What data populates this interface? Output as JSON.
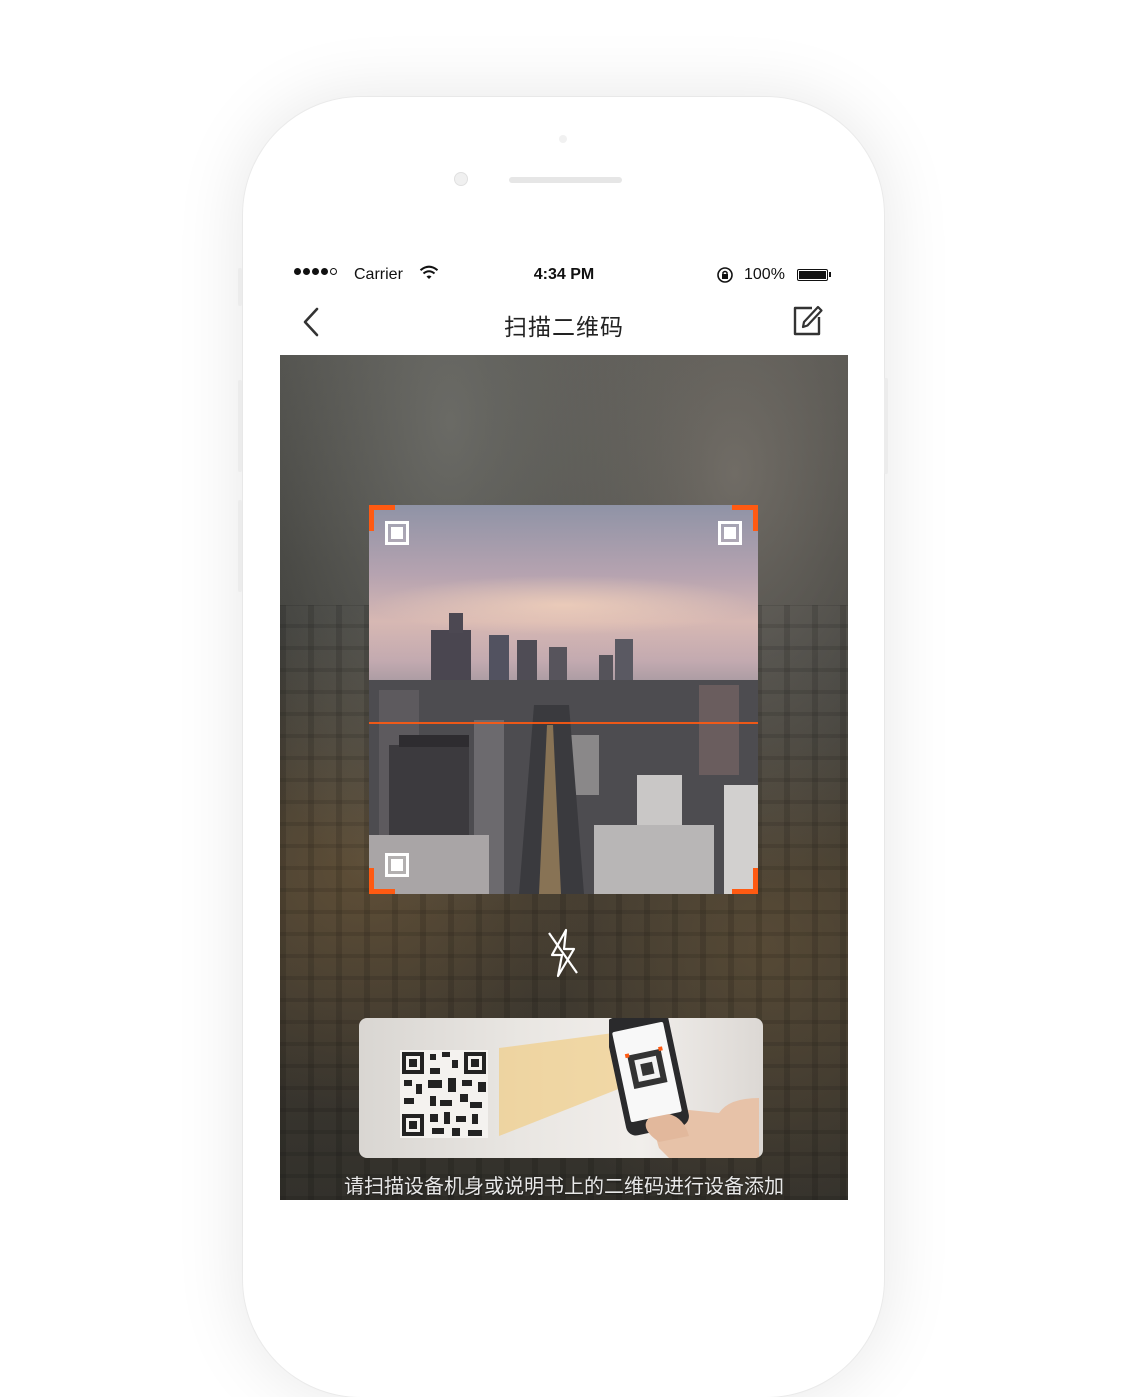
{
  "status_bar": {
    "carrier": "Carrier",
    "time": "4:34 PM",
    "battery": "100%"
  },
  "nav": {
    "title": "扫描二维码",
    "back_icon": "chevron-left-icon",
    "edit_icon": "edit-icon"
  },
  "scanner": {
    "accent_color": "#ff5a12",
    "flash_icon": "flash-off-icon"
  },
  "guide": {
    "hint": "请扫描设备机身或说明书上的二维码进行设备添加"
  }
}
